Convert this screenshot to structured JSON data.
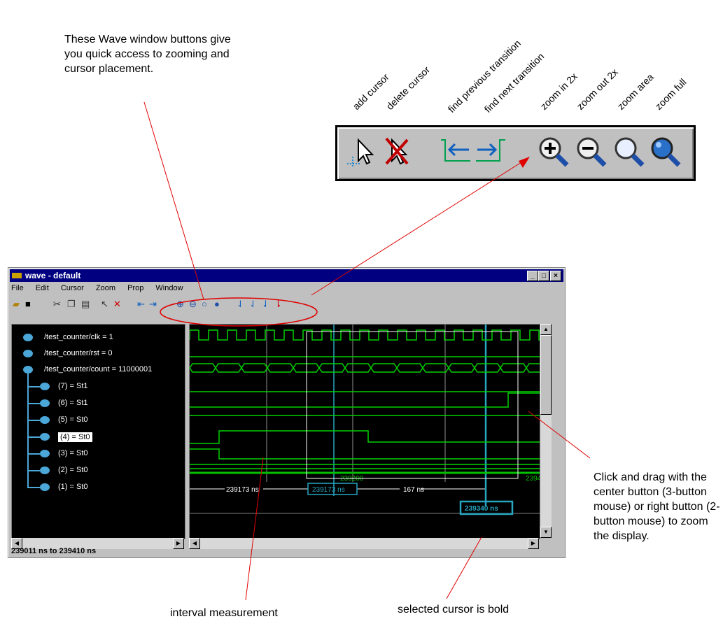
{
  "callouts": {
    "intro": "These Wave window buttons give you quick access to zooming and cursor placement.",
    "zoom": "Click and drag with the center button (3-button mouse) or right button (2-button mouse) to zoom the display.",
    "interval": "interval measurement",
    "bold": "selected cursor is bold"
  },
  "button_labels": [
    {
      "label": "add cursor",
      "icon": "add-cursor-icon"
    },
    {
      "label": "delete cursor",
      "icon": "delete-cursor-icon"
    },
    {
      "label": "find previous transition",
      "icon": "find-previous-transition-icon"
    },
    {
      "label": "find next transition",
      "icon": "find-next-transition-icon"
    },
    {
      "label": "zoom in 2x",
      "icon": "zoom-in-icon"
    },
    {
      "label": "zoom out 2x",
      "icon": "zoom-out-icon"
    },
    {
      "label": "zoom area",
      "icon": "zoom-area-icon"
    },
    {
      "label": "zoom full",
      "icon": "zoom-full-icon"
    }
  ],
  "window": {
    "title": "wave - default",
    "menu": [
      "File",
      "Edit",
      "Cursor",
      "Zoom",
      "Prop",
      "Window"
    ],
    "status": "239011 ns to 239410 ns"
  },
  "signals": [
    {
      "label": "/test_counter/clk = 1"
    },
    {
      "label": "/test_counter/rst = 0"
    },
    {
      "label": "/test_counter/count = 11000001"
    },
    {
      "label": "(7) = St1"
    },
    {
      "label": "(6) = St1"
    },
    {
      "label": "(5) = St0"
    },
    {
      "label": "(4) = St0"
    },
    {
      "label": "(3) = St0"
    },
    {
      "label": "(2) = St0"
    },
    {
      "label": "(1) = St0"
    }
  ],
  "time_axis": {
    "t1": "239200",
    "t2": "2394"
  },
  "measurements": {
    "interval1": "239173 ns",
    "cursor1": "239173 ns",
    "interval2": "167 ns",
    "cursor2": "239340 ns"
  },
  "colors": {
    "wave": "#00d000",
    "cursor": "#26a6c0",
    "titlebar": "#000080"
  }
}
